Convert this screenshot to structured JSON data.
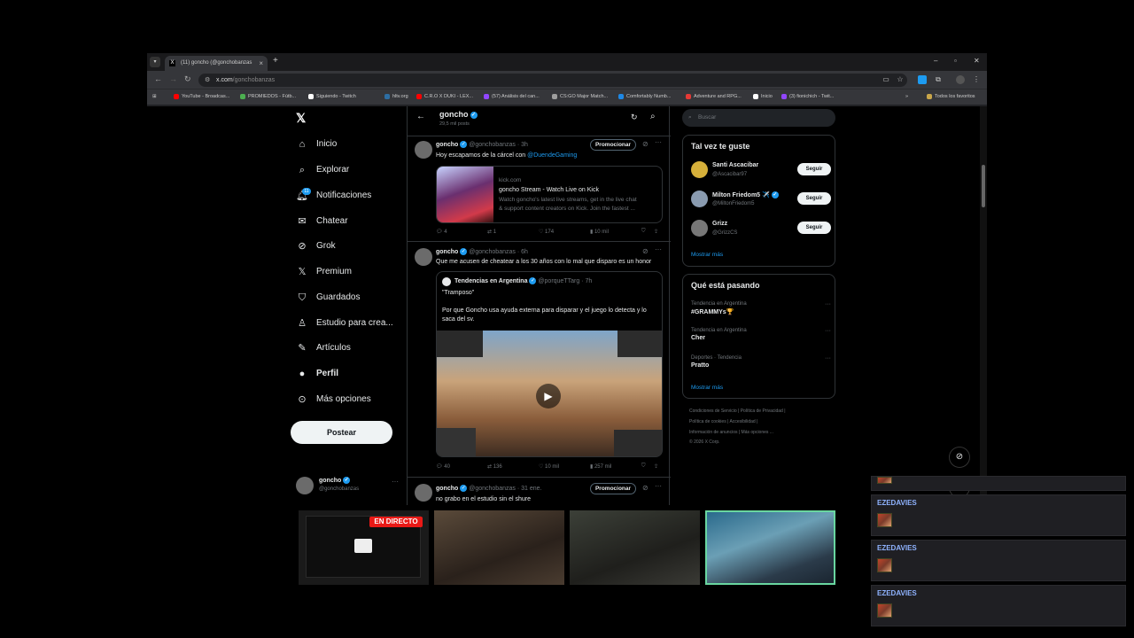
{
  "browser": {
    "tab_title": "(11) goncho (@gonchobanzas",
    "url_main": "x.com",
    "url_path": "/gonchobanzas",
    "bookmarks": [
      {
        "label": "YouTube - Broadcas...",
        "color": "#ff0000"
      },
      {
        "label": "PROMIEDOS - Fútb...",
        "color": "#4caf50"
      },
      {
        "label": "Siguiendo - Twitch",
        "color": "#9146ff"
      },
      {
        "label": "hltv.org",
        "color": "#2d6ea3"
      },
      {
        "label": "C.R.O X DUKI - LEX...",
        "color": "#ff0000"
      },
      {
        "label": "(57) Análisis del can...",
        "color": "#9146ff"
      },
      {
        "label": "CS:GO Major Match...",
        "color": "#9e9e9e"
      },
      {
        "label": "Comfortably Numb...",
        "color": "#1e88e5"
      },
      {
        "label": "Adventure and RPG...",
        "color": "#e53935"
      },
      {
        "label": "Inicio",
        "color": "#000000"
      },
      {
        "label": "(3) fionichich - Twit...",
        "color": "#9146ff"
      }
    ],
    "all_favorites": "Todos los favoritos"
  },
  "nav": {
    "items": [
      {
        "label": "Inicio",
        "icon": "home-icon"
      },
      {
        "label": "Explorar",
        "icon": "search-icon"
      },
      {
        "label": "Notificaciones",
        "icon": "bell-icon",
        "badge": "11"
      },
      {
        "label": "Chatear",
        "icon": "mail-icon"
      },
      {
        "label": "Grok",
        "icon": "grok-icon"
      },
      {
        "label": "Premium",
        "icon": "x-logo-icon"
      },
      {
        "label": "Guardados",
        "icon": "bookmark-icon"
      },
      {
        "label": "Estudio para crea...",
        "icon": "studio-icon"
      },
      {
        "label": "Artículos",
        "icon": "article-icon"
      },
      {
        "label": "Perfil",
        "icon": "person-icon"
      },
      {
        "label": "Más opciones",
        "icon": "more-icon"
      }
    ],
    "post_button": "Postear",
    "account_name": "goncho",
    "account_handle": "@gonchobanzas"
  },
  "profile_header": {
    "name": "goncho",
    "post_count": "29,5 mil posts"
  },
  "tweets": [
    {
      "name": "goncho",
      "handle": "@gonchobanzas",
      "time": "· 3h",
      "promote": "Promocionar",
      "text": "Hoy escapamos de la cárcel con ",
      "mention": "@DuendeGaming",
      "card_domain": "kick.com",
      "card_title": "goncho Stream - Watch Live on Kick",
      "card_desc_1": "Watch goncho's latest live streams, get in the live chat",
      "card_desc_2": "& support content creators on Kick. Join the fastest ...",
      "replies": "4",
      "retweets": "1",
      "likes": "174",
      "views": "10 mil"
    },
    {
      "name": "goncho",
      "handle": "@gonchobanzas",
      "time": "· 6h",
      "text": "Que me acusen de cheatear a los 30 años con lo mal que disparo es un honor",
      "quote_name": "Tendencias en Argentina",
      "quote_handle": "@porqueTTarg",
      "quote_time": "· 7h",
      "quote_line1": "\"Tramposo\"",
      "quote_line2": "Por que Goncho usa ayuda externa para disparar y el juego lo detecta y lo",
      "quote_line3": "saca del sv.",
      "replies": "40",
      "retweets": "136",
      "likes": "10 mil",
      "views": "257 mil"
    },
    {
      "name": "goncho",
      "handle": "@gonchobanzas",
      "time": "· 31 ene.",
      "promote": "Promocionar",
      "text": "no grabo en el estudio sin el shure"
    }
  ],
  "right": {
    "search_placeholder": "Buscar",
    "suggest_title": "Tal vez te guste",
    "suggestions": [
      {
        "name": "Santi Ascacibar",
        "handle": "@Ascacibar97",
        "button": "Seguir",
        "color": "#d6b03a"
      },
      {
        "name": "Milton Friedom5 ✈️",
        "handle": "@MiltonFriedom5",
        "button": "Seguir",
        "color": "#8a9bb0"
      },
      {
        "name": "Grizz",
        "handle": "@GrizzCS",
        "button": "Seguir",
        "color": "#777777"
      }
    ],
    "show_more": "Mostrar más",
    "trends_title": "Qué está pasando",
    "trends": [
      {
        "context": "Tendencia en Argentina",
        "topic": "#GRAMMYs🏆"
      },
      {
        "context": "Tendencia en Argentina",
        "topic": "Cher"
      },
      {
        "context": "Deportes · Tendencia",
        "topic": "Pratto"
      }
    ],
    "trends_more": "Mostrar más",
    "footer1": "Condiciones de Servicio  |  Política de Privacidad  |",
    "footer2": "Política de cookies  |  Accesibilidad  |",
    "footer3": "Información de anuncios  |  Más opciones ...",
    "footer4": "© 2026 X Corp."
  },
  "stream": {
    "live_label": "EN DIRECTO"
  },
  "chat": [
    {
      "user": "EZEDAVIES"
    },
    {
      "user": "EZEDAVIES"
    },
    {
      "user": "EZEDAVIES"
    }
  ]
}
